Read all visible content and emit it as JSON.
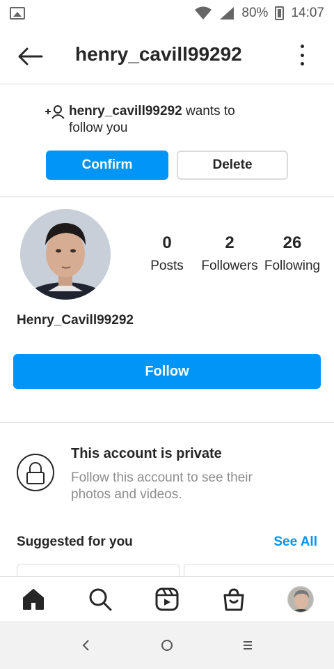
{
  "statusbar": {
    "battery_percent": "80%",
    "time": "14:07"
  },
  "header": {
    "title": "henry_cavill99292"
  },
  "follow_request": {
    "username": "henry_cavill99292",
    "message_line1_suffix": " wants to",
    "message_line2": "follow you",
    "confirm_label": "Confirm",
    "delete_label": "Delete"
  },
  "profile": {
    "posts_count": "0",
    "posts_label": "Posts",
    "followers_count": "2",
    "followers_label": "Followers",
    "following_count": "26",
    "following_label": "Following",
    "display_name": "Henry_Cavill99292",
    "follow_label": "Follow"
  },
  "private_notice": {
    "title": "This account is private",
    "description": "Follow this account to see their photos and videos."
  },
  "suggested": {
    "title": "Suggested for you",
    "see_all_label": "See All"
  },
  "colors": {
    "accent": "#0095f6",
    "text": "#262626",
    "secondary_text": "#8e8e8e",
    "divider": "#dbdbdb"
  },
  "icons": {
    "back": "arrow-left-icon",
    "menu": "more-vertical-icon",
    "request": "add-person-icon",
    "lock": "lock-icon",
    "home": "home-icon",
    "search": "search-icon",
    "reels": "reels-icon",
    "shop": "shop-icon"
  }
}
